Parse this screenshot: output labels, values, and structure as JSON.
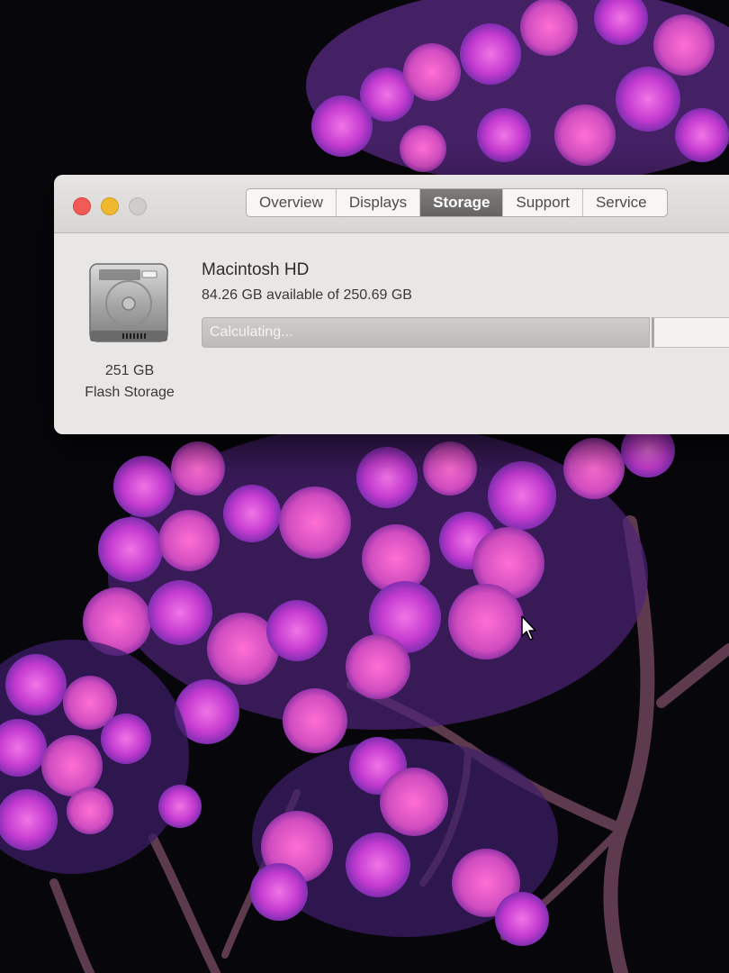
{
  "window": {
    "tabs": [
      {
        "label": "Overview"
      },
      {
        "label": "Displays"
      },
      {
        "label": "Storage"
      },
      {
        "label": "Support"
      },
      {
        "label": "Service"
      }
    ],
    "active_tab": "Storage"
  },
  "storage": {
    "drive_icon": "hard-drive-icon",
    "drive_size": "251 GB",
    "drive_type": "Flash Storage",
    "volume_name": "Macintosh HD",
    "available_text": "84.26 GB available of 250.69 GB",
    "bar_status": "Calculating..."
  },
  "colors": {
    "close": "#f05b55",
    "minimize": "#f0b82f",
    "zoom_disabled": "#cfcdcb",
    "active_tab": "#6f6d6b"
  }
}
